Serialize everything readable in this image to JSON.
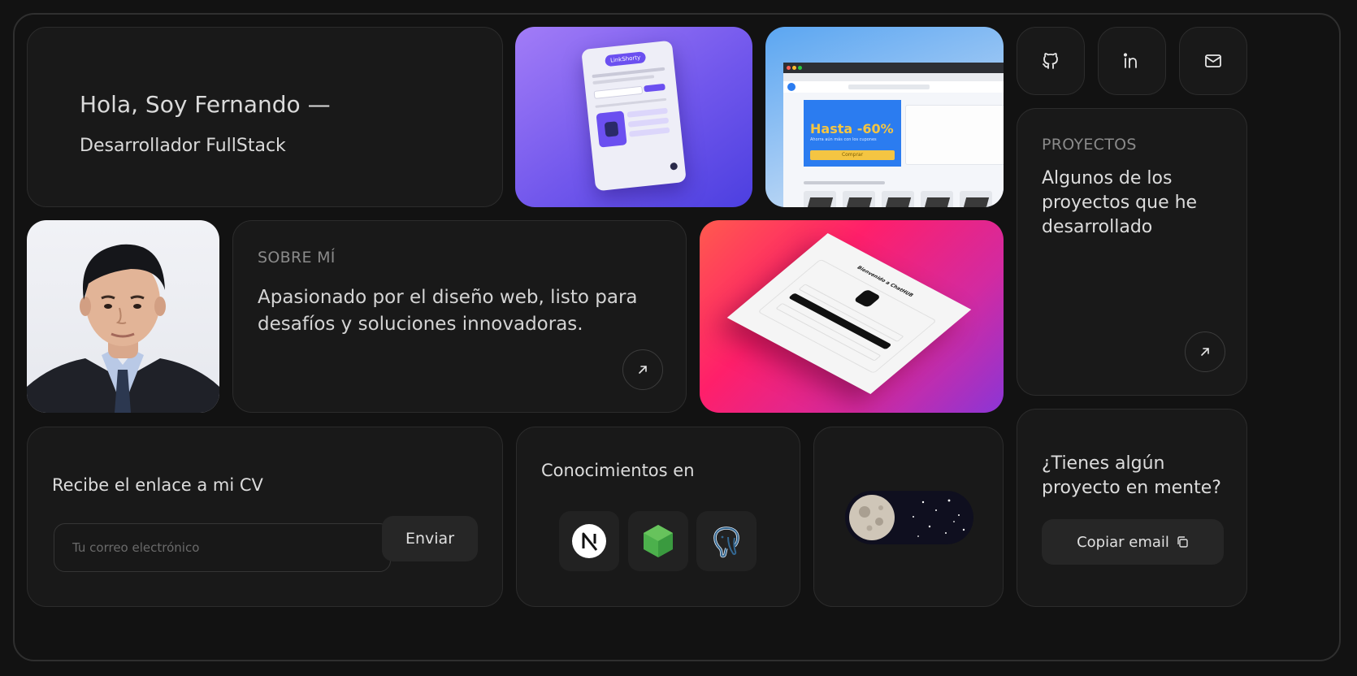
{
  "hero": {
    "title": "Hola, Soy Fernando —",
    "subtitle": "Desarrollador FullStack"
  },
  "social": {
    "icons": [
      "github-icon",
      "linkedin-icon",
      "mail-icon"
    ]
  },
  "projects": {
    "label": "PROYECTOS",
    "description": "Algunos de los proyectos que he desarrollado",
    "arrow_icon": "arrow-up-right-icon"
  },
  "about": {
    "label": "SOBRE MÍ",
    "text": "Apasionado por el diseño web, listo para desafíos y soluciones innovadoras.",
    "arrow_icon": "arrow-up-right-icon"
  },
  "screens": {
    "linkshorty": {
      "button": "LinkShorty"
    },
    "shop": {
      "promo": "Hasta -60%",
      "promo_sub": "Ahorra aún más con los cupones",
      "cta": "Comprar"
    },
    "chat": {
      "welcome": "Bienvenido a ChatHUB"
    }
  },
  "cv": {
    "title": "Recibe el enlace a mi CV",
    "placeholder": "Tu correo electrónico",
    "send": "Enviar"
  },
  "skills": {
    "title": "Conocimientos en",
    "logos": [
      "nextjs-logo",
      "nodejs-logo",
      "postgresql-logo"
    ]
  },
  "theme": {
    "toggle_icon": "moon-icon",
    "state": "dark"
  },
  "contact": {
    "question": "¿Tienes algún proyecto en mente?",
    "copy_label": "Copiar email",
    "copy_icon": "copy-icon"
  },
  "colors": {
    "background": "#121212",
    "card": "#191919",
    "border": "#2c2c2c",
    "purple_start": "#a27cf7",
    "purple_end": "#4c3fe0",
    "blue_start": "#5ba6f2",
    "blue_end": "#dfe9f6",
    "pink_start": "#ff3d6e",
    "pink_end": "#8b35d6",
    "promo_yellow": "#f4c542",
    "promo_blue": "#2b7cf0"
  }
}
